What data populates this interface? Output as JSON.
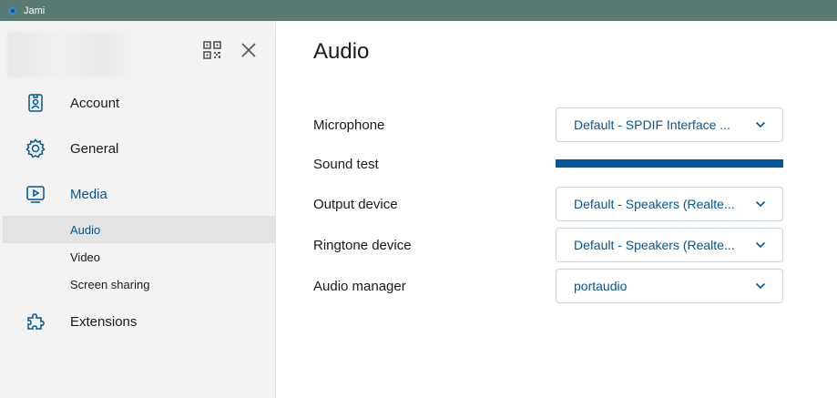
{
  "window": {
    "title": "Jami"
  },
  "sidebar": {
    "nav": [
      {
        "label": "Account",
        "icon": "account-badge-icon"
      },
      {
        "label": "General",
        "icon": "gear-icon"
      },
      {
        "label": "Media",
        "icon": "media-play-icon"
      },
      {
        "label": "Extensions",
        "icon": "puzzle-icon"
      }
    ],
    "media_sub": [
      {
        "label": "Audio",
        "selected": true
      },
      {
        "label": "Video",
        "selected": false
      },
      {
        "label": "Screen sharing",
        "selected": false
      }
    ]
  },
  "main": {
    "title": "Audio",
    "microphone": {
      "label": "Microphone",
      "value": "Default - SPDIF Interface ..."
    },
    "sound_test": {
      "label": "Sound test",
      "level": 1.0
    },
    "output_device": {
      "label": "Output device",
      "value": "Default - Speakers (Realte..."
    },
    "ringtone_device": {
      "label": "Ringtone device",
      "value": "Default - Speakers (Realte..."
    },
    "audio_manager": {
      "label": "Audio manager",
      "value": "portaudio"
    }
  },
  "colors": {
    "accent": "#005699",
    "titlebar": "#5c7a74",
    "sidebar_bg": "#f3f3f3",
    "selected_bg": "#e3e3e3"
  }
}
